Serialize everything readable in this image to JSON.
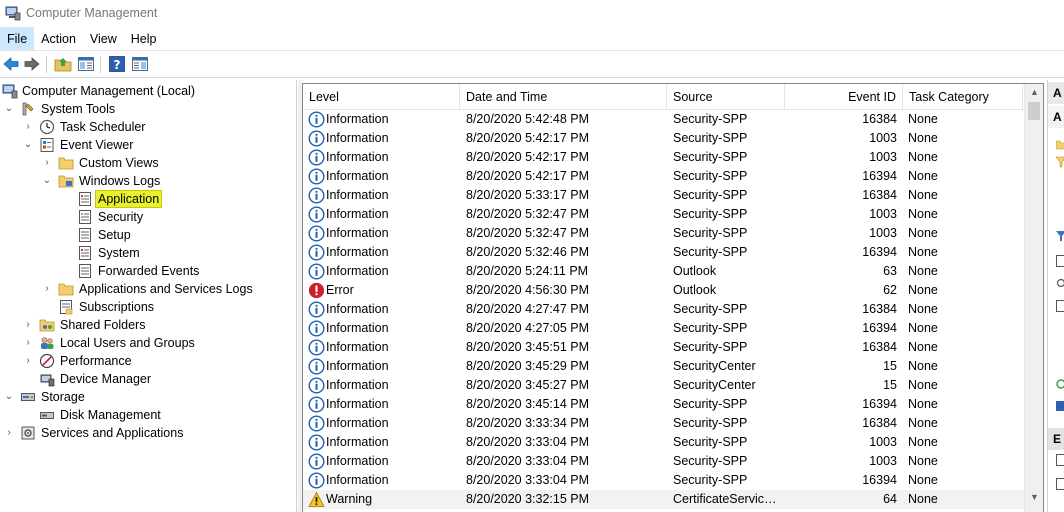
{
  "window": {
    "title": "Computer Management"
  },
  "menu": {
    "items": [
      "File",
      "Action",
      "View",
      "Help"
    ]
  },
  "tree": {
    "root": "Computer Management (Local)",
    "system_tools": "System Tools",
    "task_scheduler": "Task Scheduler",
    "event_viewer": "Event Viewer",
    "custom_views": "Custom Views",
    "windows_logs": "Windows Logs",
    "application": "Application",
    "security": "Security",
    "setup": "Setup",
    "system": "System",
    "forwarded_events": "Forwarded Events",
    "apps_services_logs": "Applications and Services Logs",
    "subscriptions": "Subscriptions",
    "shared_folders": "Shared Folders",
    "local_users_groups": "Local Users and Groups",
    "performance": "Performance",
    "device_manager": "Device Manager",
    "storage": "Storage",
    "disk_management": "Disk Management",
    "services_apps": "Services and Applications"
  },
  "columns": {
    "level": "Level",
    "datetime": "Date and Time",
    "source": "Source",
    "event_id": "Event ID",
    "task_category": "Task Category"
  },
  "events": [
    {
      "level": "Information",
      "icon": "info-icon",
      "datetime": "8/20/2020 5:42:48 PM",
      "source": "Security-SPP",
      "event_id": "16384",
      "category": "None"
    },
    {
      "level": "Information",
      "icon": "info-icon",
      "datetime": "8/20/2020 5:42:17 PM",
      "source": "Security-SPP",
      "event_id": "1003",
      "category": "None"
    },
    {
      "level": "Information",
      "icon": "info-icon",
      "datetime": "8/20/2020 5:42:17 PM",
      "source": "Security-SPP",
      "event_id": "1003",
      "category": "None"
    },
    {
      "level": "Information",
      "icon": "info-icon",
      "datetime": "8/20/2020 5:42:17 PM",
      "source": "Security-SPP",
      "event_id": "16394",
      "category": "None"
    },
    {
      "level": "Information",
      "icon": "info-icon",
      "datetime": "8/20/2020 5:33:17 PM",
      "source": "Security-SPP",
      "event_id": "16384",
      "category": "None"
    },
    {
      "level": "Information",
      "icon": "info-icon",
      "datetime": "8/20/2020 5:32:47 PM",
      "source": "Security-SPP",
      "event_id": "1003",
      "category": "None"
    },
    {
      "level": "Information",
      "icon": "info-icon",
      "datetime": "8/20/2020 5:32:47 PM",
      "source": "Security-SPP",
      "event_id": "1003",
      "category": "None"
    },
    {
      "level": "Information",
      "icon": "info-icon",
      "datetime": "8/20/2020 5:32:46 PM",
      "source": "Security-SPP",
      "event_id": "16394",
      "category": "None"
    },
    {
      "level": "Information",
      "icon": "info-icon",
      "datetime": "8/20/2020 5:24:11 PM",
      "source": "Outlook",
      "event_id": "63",
      "category": "None"
    },
    {
      "level": "Error",
      "icon": "error-icon",
      "datetime": "8/20/2020 4:56:30 PM",
      "source": "Outlook",
      "event_id": "62",
      "category": "None"
    },
    {
      "level": "Information",
      "icon": "info-icon",
      "datetime": "8/20/2020 4:27:47 PM",
      "source": "Security-SPP",
      "event_id": "16384",
      "category": "None"
    },
    {
      "level": "Information",
      "icon": "info-icon",
      "datetime": "8/20/2020 4:27:05 PM",
      "source": "Security-SPP",
      "event_id": "16394",
      "category": "None"
    },
    {
      "level": "Information",
      "icon": "info-icon",
      "datetime": "8/20/2020 3:45:51 PM",
      "source": "Security-SPP",
      "event_id": "16384",
      "category": "None"
    },
    {
      "level": "Information",
      "icon": "info-icon",
      "datetime": "8/20/2020 3:45:29 PM",
      "source": "SecurityCenter",
      "event_id": "15",
      "category": "None"
    },
    {
      "level": "Information",
      "icon": "info-icon",
      "datetime": "8/20/2020 3:45:27 PM",
      "source": "SecurityCenter",
      "event_id": "15",
      "category": "None"
    },
    {
      "level": "Information",
      "icon": "info-icon",
      "datetime": "8/20/2020 3:45:14 PM",
      "source": "Security-SPP",
      "event_id": "16394",
      "category": "None"
    },
    {
      "level": "Information",
      "icon": "info-icon",
      "datetime": "8/20/2020 3:33:34 PM",
      "source": "Security-SPP",
      "event_id": "16384",
      "category": "None"
    },
    {
      "level": "Information",
      "icon": "info-icon",
      "datetime": "8/20/2020 3:33:04 PM",
      "source": "Security-SPP",
      "event_id": "1003",
      "category": "None"
    },
    {
      "level": "Information",
      "icon": "info-icon",
      "datetime": "8/20/2020 3:33:04 PM",
      "source": "Security-SPP",
      "event_id": "1003",
      "category": "None"
    },
    {
      "level": "Information",
      "icon": "info-icon",
      "datetime": "8/20/2020 3:33:04 PM",
      "source": "Security-SPP",
      "event_id": "16394",
      "category": "None"
    },
    {
      "level": "Warning",
      "icon": "warning-icon",
      "datetime": "8/20/2020 3:32:15 PM",
      "source": "CertificateServices...",
      "event_id": "64",
      "category": "None"
    }
  ],
  "actions_pane": {
    "header_a": "A",
    "header_b": "A",
    "header_e": "E"
  },
  "colors": {
    "selection": "#e9f02e",
    "menu_active": "#cce8ff",
    "info_blue": "#1f5fae",
    "error_red": "#c8202c",
    "warning_yellow": "#f4c51e"
  }
}
